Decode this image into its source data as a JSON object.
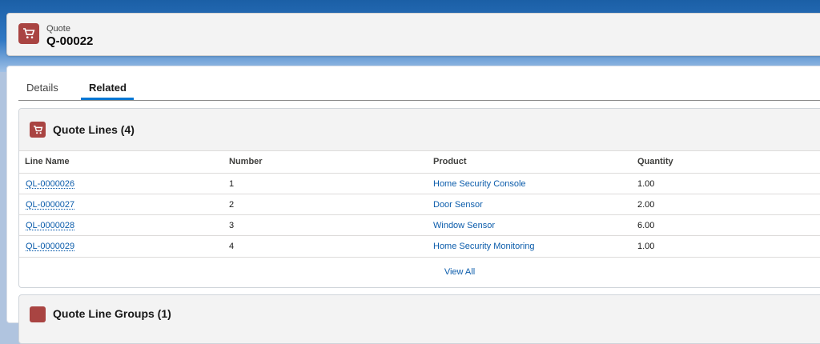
{
  "record": {
    "type_label": "Quote",
    "name": "Q-00022",
    "icon": "cart-icon"
  },
  "tabs": [
    {
      "label": "Details",
      "active": false
    },
    {
      "label": "Related",
      "active": true
    }
  ],
  "related_list": {
    "title": "Quote Lines (4)",
    "icon": "cart-icon",
    "columns": [
      "Line Name",
      "Number",
      "Product",
      "Quantity"
    ],
    "rows": [
      {
        "line_name": "QL-0000026",
        "number": "1",
        "product": "Home Security Console",
        "quantity": "1.00"
      },
      {
        "line_name": "QL-0000027",
        "number": "2",
        "product": "Door Sensor",
        "quantity": "2.00"
      },
      {
        "line_name": "QL-0000028",
        "number": "3",
        "product": "Window Sensor",
        "quantity": "6.00"
      },
      {
        "line_name": "QL-0000029",
        "number": "4",
        "product": "Home Security Monitoring",
        "quantity": "1.00"
      }
    ],
    "view_all": "View All"
  },
  "related_list_2": {
    "title": "Quote Line Groups (1)"
  },
  "colors": {
    "accent": "#0176d3",
    "icon_bg": "#a94442",
    "link": "#0b5cab"
  }
}
